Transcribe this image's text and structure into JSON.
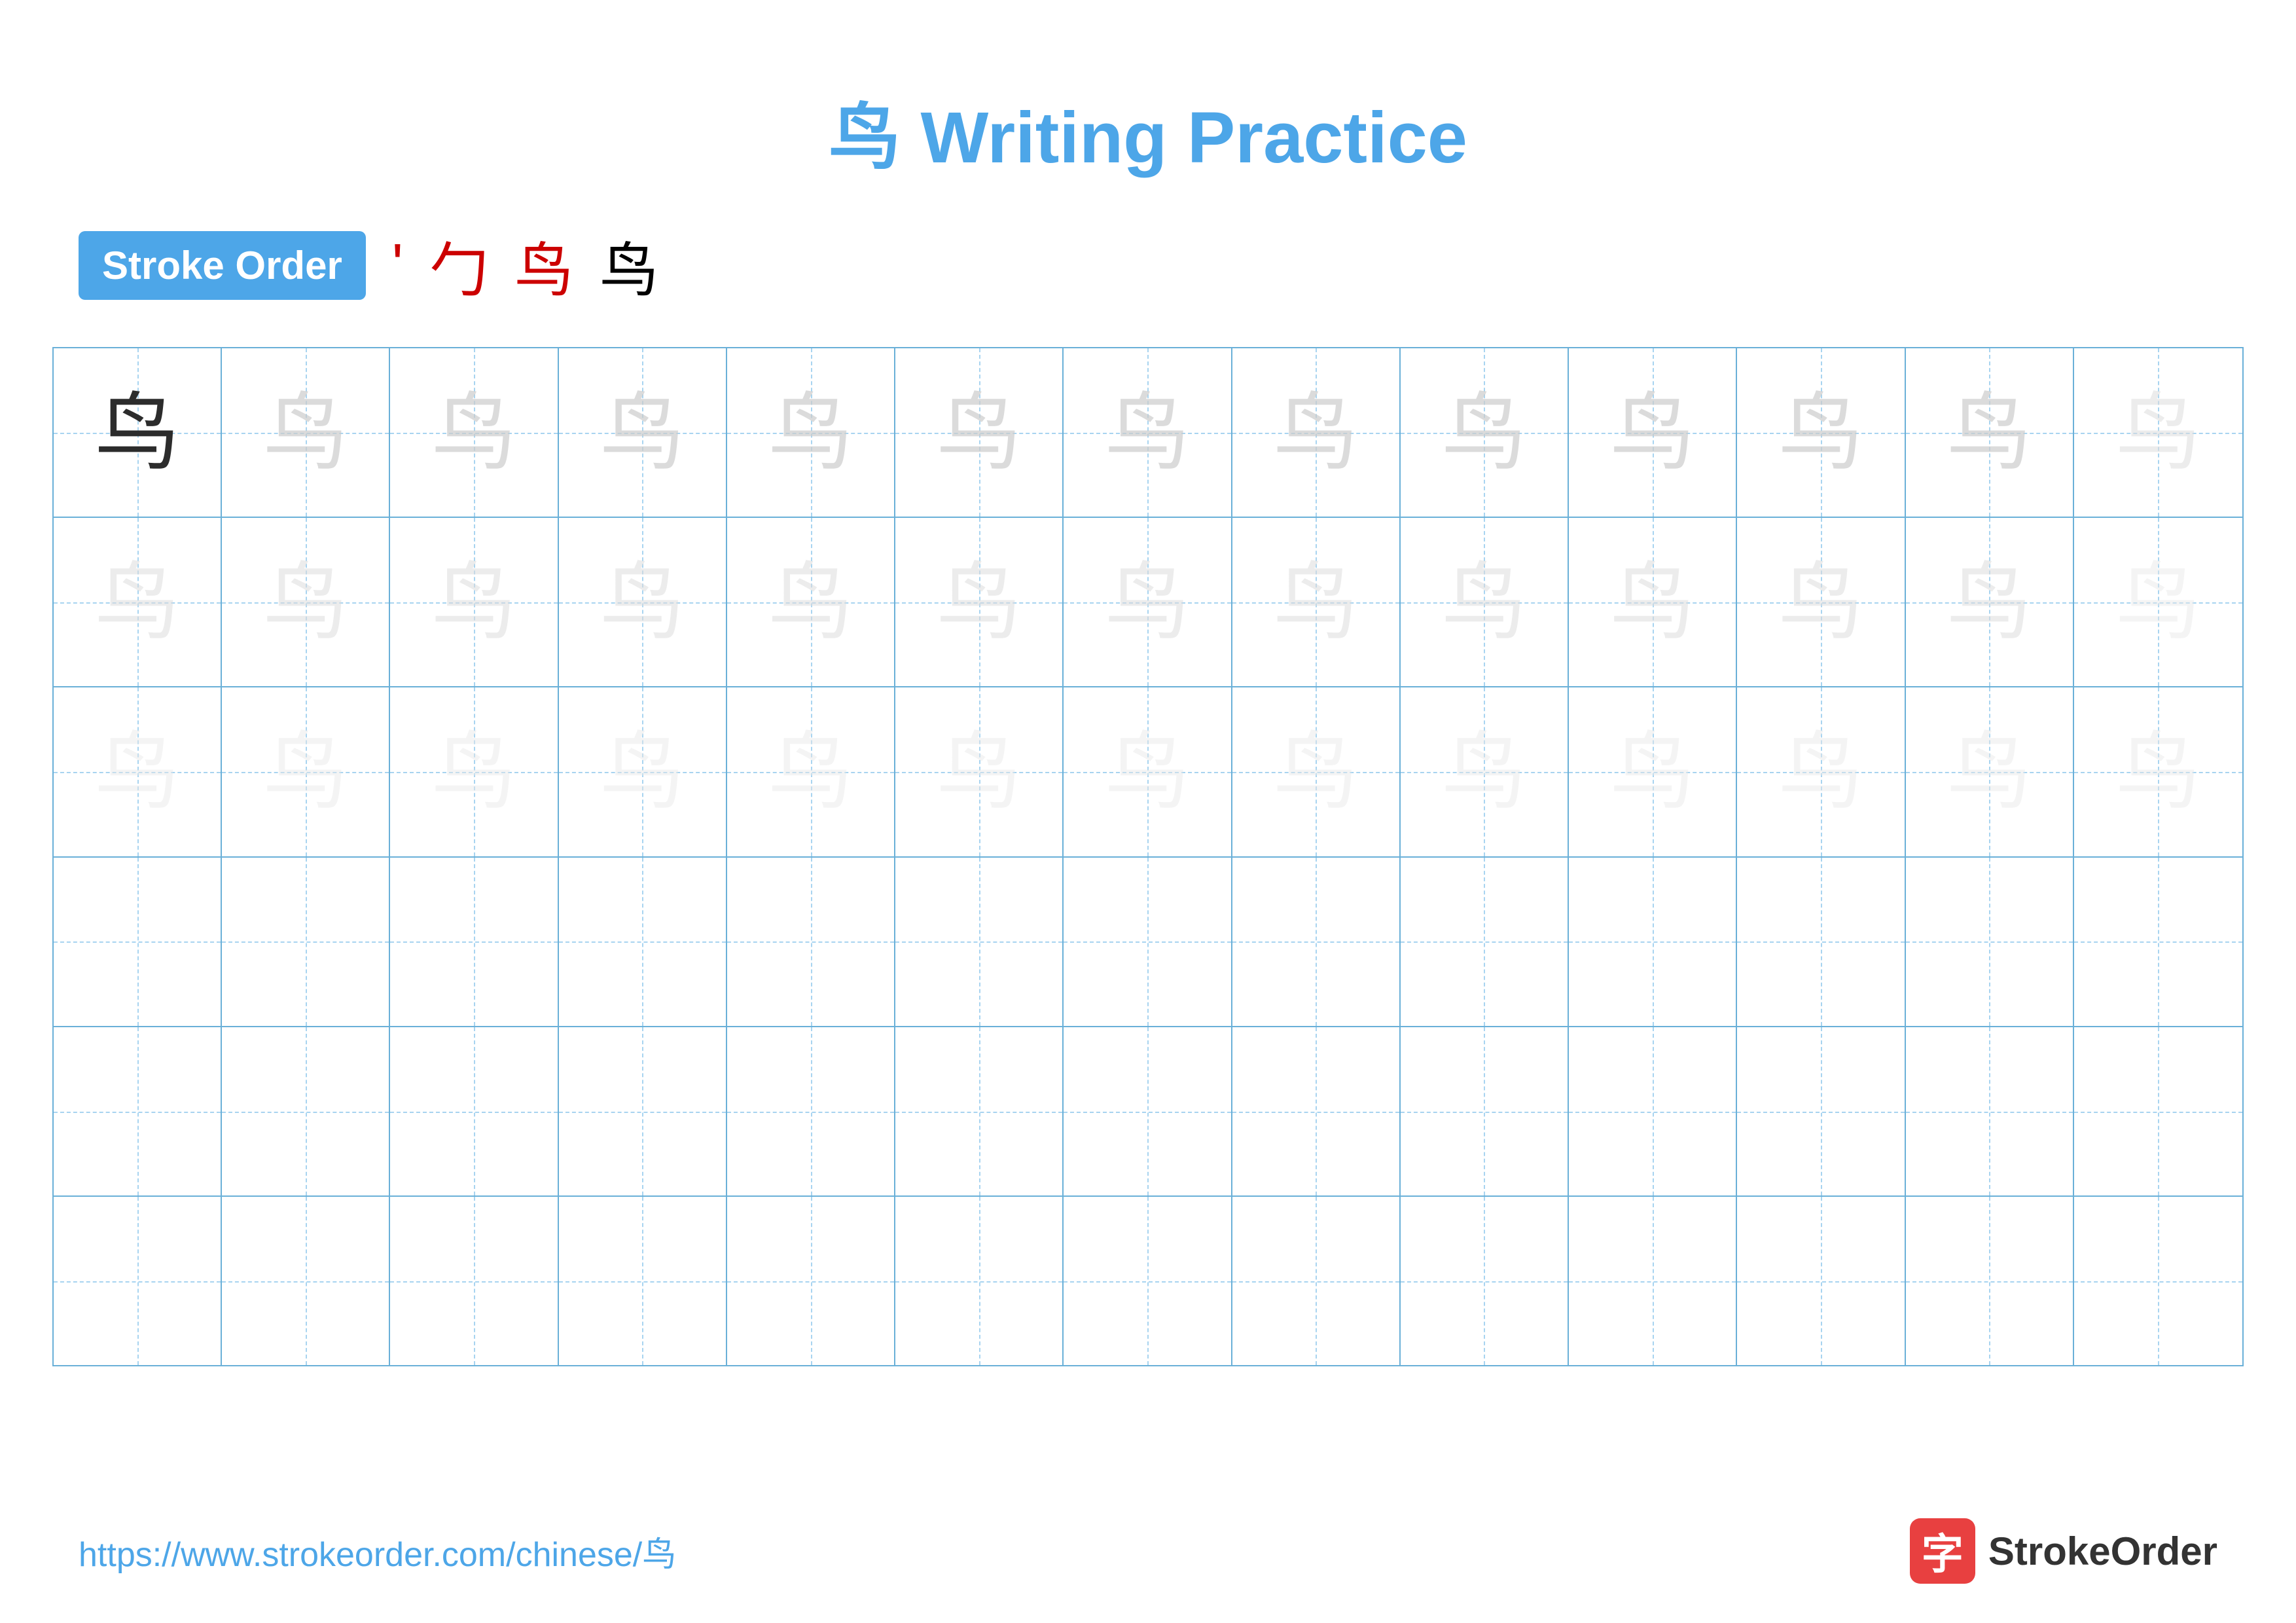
{
  "title": {
    "text": "鸟 Writing Practice",
    "color": "#4da6e8"
  },
  "strokeOrder": {
    "badge": "Stroke Order",
    "strokes": [
      "'",
      "勹",
      "鸟",
      "鸟"
    ]
  },
  "character": "鸟",
  "grid": {
    "rows": 6,
    "cols": 13
  },
  "footer": {
    "url": "https://www.strokeorder.com/chinese/鸟",
    "logoText": "StrokeOrder",
    "logoIcon": "字"
  }
}
